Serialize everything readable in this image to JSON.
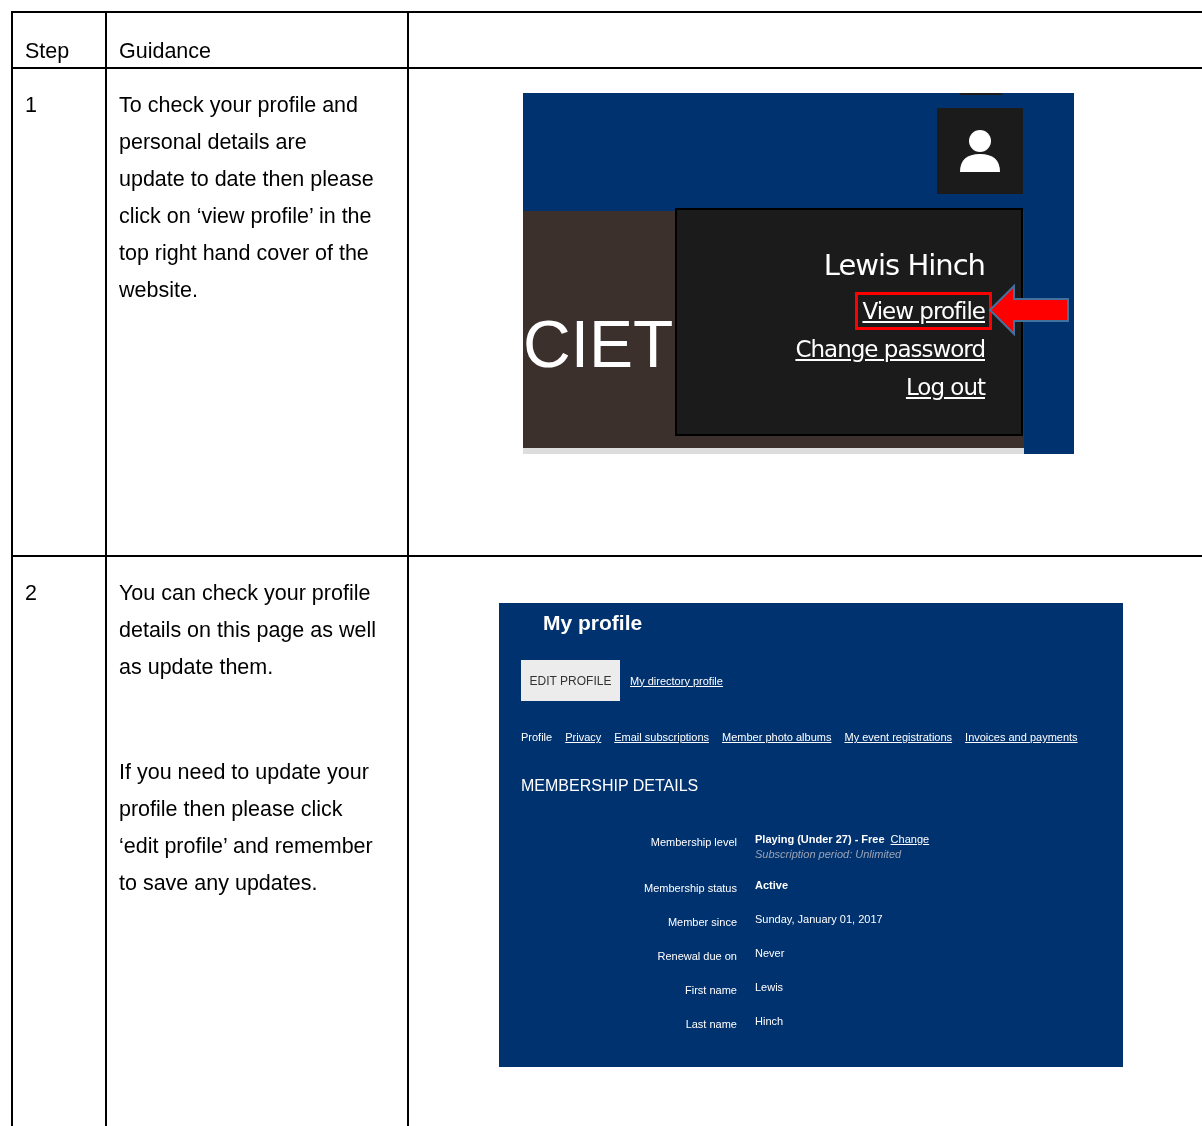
{
  "table": {
    "columns": [
      "Step",
      "Guidance"
    ],
    "rows": [
      {
        "step": "1",
        "guidance": [
          "To check your profile and personal details are update to date then please click on ‘view profile’ in the top right hand cover of the website."
        ],
        "screenshot": {
          "kind": "account-menu",
          "brand_text": "CIET",
          "user_name": "Lewis Hinch",
          "links": [
            {
              "label": "View profile",
              "highlighted": true
            },
            {
              "label": "Change password",
              "highlighted": false
            },
            {
              "label": "Log out",
              "highlighted": false
            }
          ]
        }
      },
      {
        "step": "2",
        "guidance": [
          "You can check your profile details on this page as well as update them.",
          "If you need to update your profile then please click ‘edit profile’ and remember to save any updates."
        ],
        "screenshot": {
          "kind": "profile-page",
          "title": "My profile",
          "edit_button": "EDIT PROFILE",
          "directory_link": "My directory profile",
          "tabs": [
            {
              "label": "Profile",
              "selected": true
            },
            {
              "label": "Privacy",
              "selected": false
            },
            {
              "label": "Email subscriptions",
              "selected": false
            },
            {
              "label": "Member photo albums",
              "selected": false
            },
            {
              "label": "My event registrations",
              "selected": false
            },
            {
              "label": "Invoices and payments",
              "selected": false
            }
          ],
          "section_heading": "MEMBERSHIP DETAILS",
          "details": [
            {
              "label": "Membership level",
              "value": "Playing (Under 27) - Free",
              "bold": true,
              "link": "Change",
              "note": "Subscription period: Unlimited"
            },
            {
              "label": "Membership status",
              "value": "Active",
              "bold": true
            },
            {
              "label": "Member since",
              "value": "Sunday, January 01, 2017",
              "bold": false
            },
            {
              "label": "Renewal due on",
              "value": "Never",
              "bold": false
            },
            {
              "label": "First name",
              "value": "Lewis",
              "bold": false
            },
            {
              "label": "Last name",
              "value": "Hinch",
              "bold": false
            }
          ]
        }
      }
    ]
  }
}
